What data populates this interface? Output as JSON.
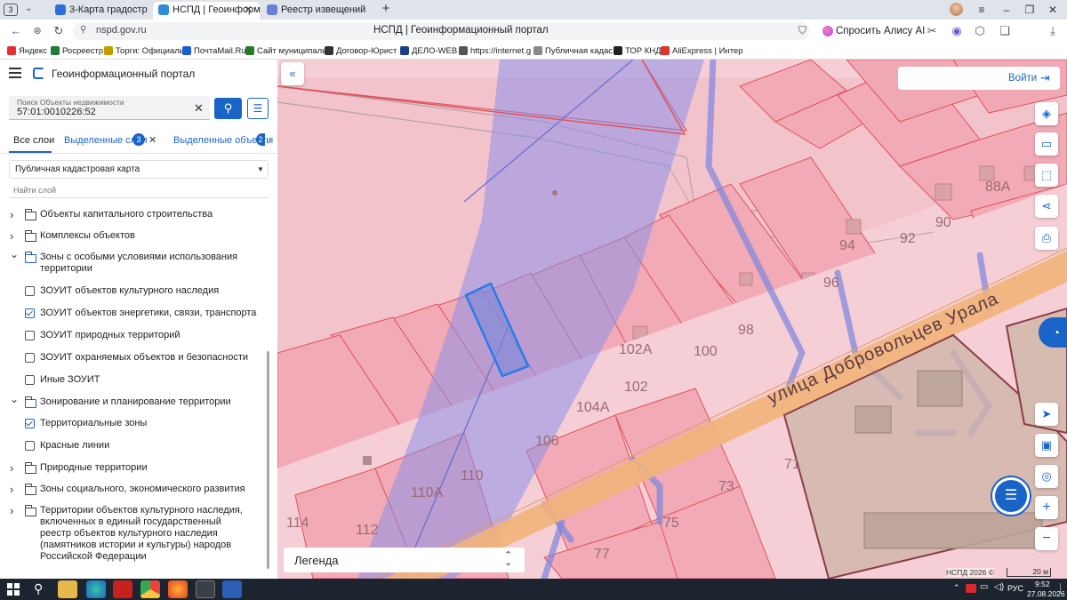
{
  "browser": {
    "tab_counter": "3",
    "tabs": [
      {
        "label": "3-Карта градостроительн",
        "icon_color": "#2f6fd8",
        "active": false
      },
      {
        "label": "НСПД | Геоинформацион",
        "icon_color": "#2f8cd8",
        "active": true
      },
      {
        "label": "Реестр извещений",
        "icon_color": "#6b7fd8",
        "active": false
      }
    ],
    "new_tab": "+",
    "url": "nspd.gov.ru",
    "page_title": "НСПД | Геоинформационный портал",
    "alice_label": "Спросить Алису AI",
    "bookmarks": [
      {
        "label": "Яндекс",
        "icon_color": "#e62e2e"
      },
      {
        "label": "Росреестр",
        "icon_color": "#1f7a3a"
      },
      {
        "label": "Торги: Официаль",
        "icon_color": "#c0a000"
      },
      {
        "label": "ПочтаMail.Ru",
        "icon_color": "#1a5fd0"
      },
      {
        "label": "Сайт муниципаль",
        "icon_color": "#2b7a2b"
      },
      {
        "label": "Договор-Юрист",
        "icon_color": "#333333"
      },
      {
        "label": "ДЕЛО-WEB",
        "icon_color": "#1a3f8a"
      },
      {
        "label": "https://internet.g",
        "icon_color": "#555555"
      },
      {
        "label": "Публичная кадас",
        "icon_color": "#888888"
      },
      {
        "label": "ТОР КНД",
        "icon_color": "#222222"
      },
      {
        "label": "AliExpress | Интер",
        "icon_color": "#e0342a"
      }
    ]
  },
  "app": {
    "title": "Геоинформационный портал",
    "search": {
      "label": "Поиск Объекты недвижимости",
      "value": "57:01:0010226:52"
    },
    "tabs": [
      {
        "label": "Все слои",
        "badge": ""
      },
      {
        "label": "Выделенные слои",
        "badge": "3"
      },
      {
        "label": "Выделенные объекты",
        "badge": "2"
      }
    ],
    "basemap_select": "Публичная кадастровая карта",
    "find_layer_placeholder": "Найти слой",
    "layers": [
      {
        "type": "group",
        "expanded": false,
        "label": "Объекты капитального строительства"
      },
      {
        "type": "group",
        "expanded": false,
        "label": "Комплексы объектов"
      },
      {
        "type": "group",
        "expanded": true,
        "label": "Зоны с особыми условиями использования территории"
      },
      {
        "type": "check",
        "checked": false,
        "label": "ЗОУИТ объектов культурного наследия"
      },
      {
        "type": "check",
        "checked": true,
        "label": "ЗОУИТ объектов энергетики, связи, транспорта"
      },
      {
        "type": "check",
        "checked": false,
        "label": "ЗОУИТ природных территорий"
      },
      {
        "type": "check",
        "checked": false,
        "label": "ЗОУИТ охраняемых объектов и безопасности"
      },
      {
        "type": "check",
        "checked": false,
        "label": "Иные ЗОУИТ"
      },
      {
        "type": "group",
        "expanded": true,
        "label": "Зонирование и планирование территории"
      },
      {
        "type": "check",
        "checked": true,
        "label": "Территориальные зоны"
      },
      {
        "type": "check",
        "checked": false,
        "label": "Красные линии"
      },
      {
        "type": "group",
        "expanded": false,
        "label": "Природные территории"
      },
      {
        "type": "group",
        "expanded": false,
        "label": "Зоны социального, экономического развития"
      },
      {
        "type": "group",
        "expanded": false,
        "label": "Территории объектов культурного наследия, включенных в единый государственный реестр объектов культурного наследия (памятников истории и культуры) народов Российской Федерации"
      }
    ]
  },
  "map": {
    "login_label": "Войти",
    "street_name": "улица Добровольцев Урала",
    "house_numbers": [
      "88А",
      "90",
      "92",
      "94",
      "96",
      "98",
      "100",
      "102А",
      "102",
      "104А",
      "106",
      "110",
      "110А",
      "112",
      "114",
      "73",
      "75",
      "77",
      "71"
    ],
    "legend_label": "Легенда",
    "attribution": "НСПД 2026 ©",
    "scale_label": "20 м",
    "colors": {
      "zone_fill": "#f6cfd6",
      "parcel_stroke": "#e0525c",
      "corridor": "#7a86e0",
      "road": "#f2b27a",
      "selected": "#2a7be8",
      "building": "#d9a3a9"
    }
  },
  "taskbar": {
    "lang": "РУС",
    "time": "9:52",
    "date": "27.08.2026"
  }
}
